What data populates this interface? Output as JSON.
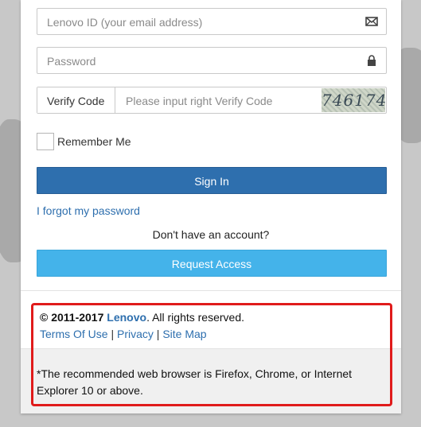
{
  "form": {
    "email_placeholder": "Lenovo ID (your email address)",
    "password_placeholder": "Password",
    "verify_label": "Verify Code",
    "verify_placeholder": "Please input right Verify Code",
    "captcha_text": "746174",
    "remember_label": "Remember Me",
    "remember_checked": false,
    "signin_label": "Sign In",
    "forgot_label": "I forgot my password",
    "no_account_text": "Don't have an account?",
    "request_label": "Request Access"
  },
  "footer": {
    "copyright_year": "© 2011-2017",
    "brand": "Lenovo",
    "rights": ". All rights reserved.",
    "links": [
      "Terms Of Use",
      "Privacy",
      "Site Map"
    ],
    "separator": "|",
    "browser_notice": "*The recommended web browser is Firefox, Chrome, or Internet Explorer 10 or above."
  },
  "colors": {
    "primary_button": "#2e6fae",
    "secondary_button": "#44b3ea",
    "link": "#2e6fae",
    "highlight_border": "#e01b1b"
  },
  "icons": {
    "email": "envelope-icon",
    "password": "lock-icon"
  }
}
